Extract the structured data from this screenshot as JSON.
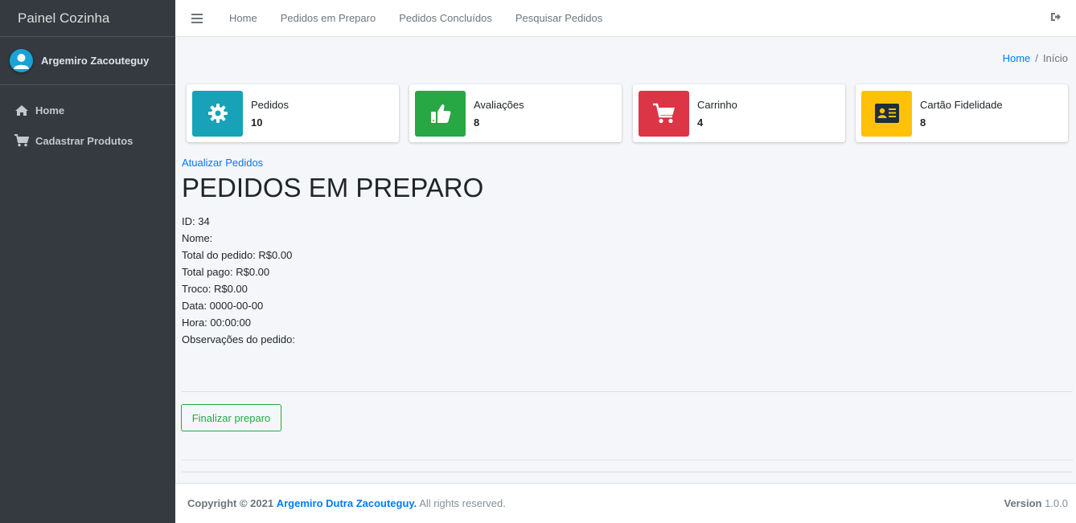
{
  "sidebar": {
    "brand": "Painel Cozinha",
    "user_name": "Argemiro Zacouteguy",
    "items": [
      {
        "label": "Home",
        "icon": "home-icon"
      },
      {
        "label": "Cadastrar Produtos",
        "icon": "cart-icon"
      }
    ]
  },
  "topbar": {
    "links": [
      "Home",
      "Pedidos em Preparo",
      "Pedidos Concluídos",
      "Pesquisar Pedidos"
    ],
    "logout_icon": "sign-out-icon"
  },
  "breadcrumb": {
    "home": "Home",
    "sep": "/",
    "current": "Início"
  },
  "info_boxes": [
    {
      "label": "Pedidos",
      "value": "10",
      "color": "#17a2b8",
      "icon": "gear-icon"
    },
    {
      "label": "Avaliações",
      "value": "8",
      "color": "#28a745",
      "icon": "thumbs-up-icon"
    },
    {
      "label": "Carrinho",
      "value": "4",
      "color": "#dc3545",
      "icon": "cart-icon"
    },
    {
      "label": "Cartão Fidelidade",
      "value": "8",
      "color": "#ffc107",
      "icon": "id-card-icon"
    }
  ],
  "main": {
    "refresh_link": "Atualizar Pedidos",
    "heading": "PEDIDOS EM PREPARO",
    "details": [
      "ID: 34",
      "Nome:",
      "Total do pedido: R$0.00",
      "Total pago: R$0.00",
      "Troco: R$0.00",
      "Data: 0000-00-00",
      "Hora: 00:00:00",
      "Observações do pedido:"
    ],
    "finish_button": "Finalizar preparo"
  },
  "footer": {
    "copyright_prefix": "Copyright © 2021",
    "author": "Argemiro Dutra Zacouteguy.",
    "rights": "All rights reserved.",
    "version_label": "Version",
    "version": "1.0.0"
  }
}
